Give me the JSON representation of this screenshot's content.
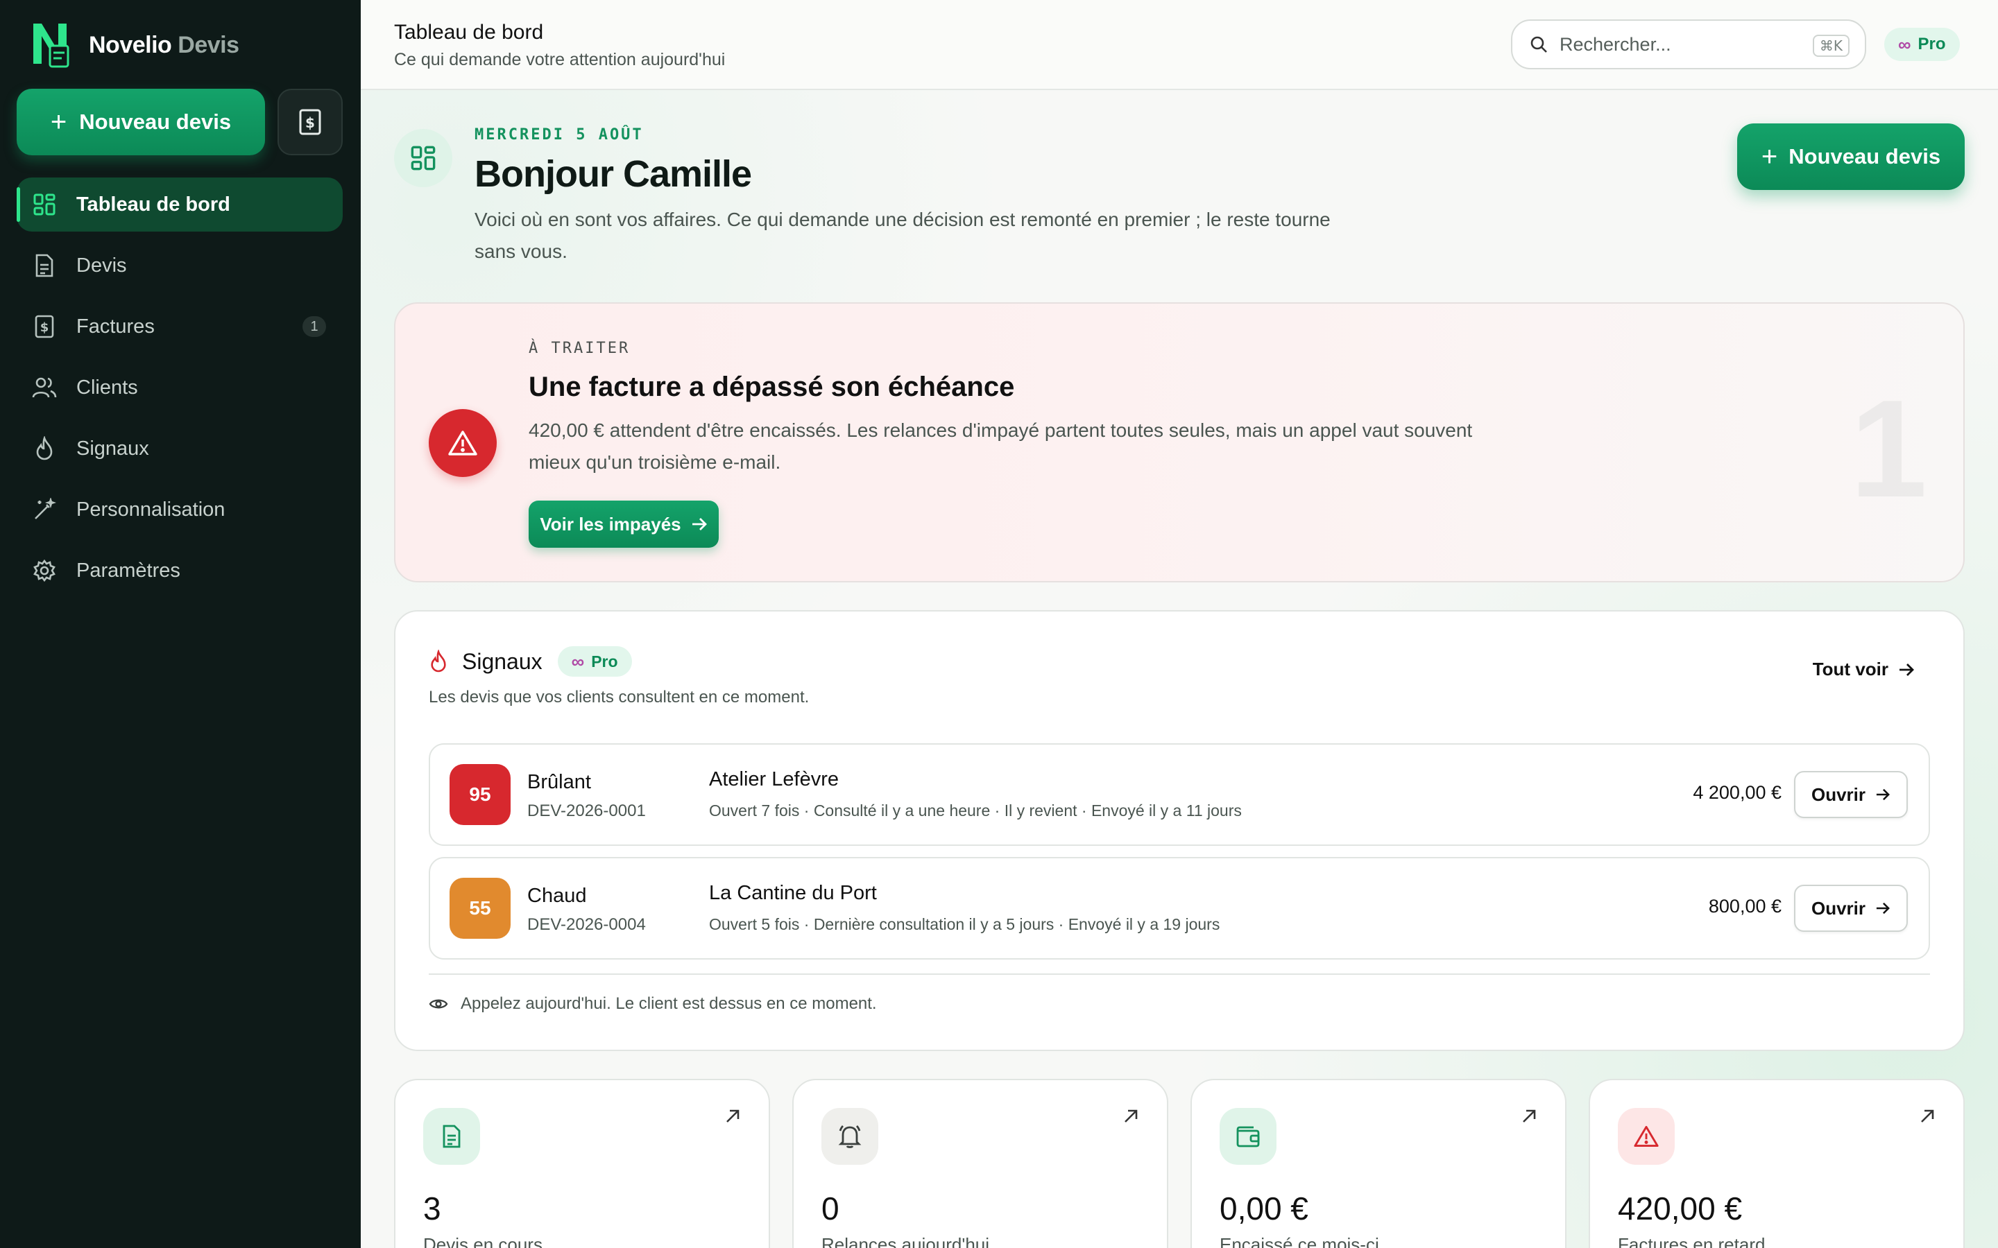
{
  "brand": {
    "name": "Novelio",
    "product": "Devis"
  },
  "sidebar": {
    "new_quote_label": "Nouveau devis",
    "items": [
      {
        "label": "Tableau de bord",
        "icon": "dashboard-icon",
        "active": true
      },
      {
        "label": "Devis",
        "icon": "document-icon"
      },
      {
        "label": "Factures",
        "icon": "invoice-icon",
        "badge": "1"
      },
      {
        "label": "Clients",
        "icon": "users-icon"
      },
      {
        "label": "Signaux",
        "icon": "flame-icon"
      },
      {
        "label": "Personnalisation",
        "icon": "magic-wand-icon"
      },
      {
        "label": "Paramètres",
        "icon": "gear-icon"
      }
    ]
  },
  "topbar": {
    "title": "Tableau de bord",
    "subtitle": "Ce qui demande votre attention aujourd'hui",
    "search_placeholder": "Rechercher...",
    "shortcut": "⌘K",
    "plan": "Pro"
  },
  "hero": {
    "date": "MERCREDI 5 AOÛT",
    "greeting": "Bonjour Camille",
    "intro": "Voici où en sont vos affaires. Ce qui demande une décision est remonté en premier ; le reste tourne sans vous.",
    "new_quote_label": "Nouveau devis"
  },
  "alert": {
    "kicker": "À TRAITER",
    "title": "Une facture a dépassé son échéance",
    "text": "420,00 € attendent d'être encaissés. Les relances d'impayé partent toutes seules, mais un appel vaut souvent mieux qu'un troisième e-mail.",
    "cta": "Voir les impayés",
    "count": "1"
  },
  "signals": {
    "title": "Signaux",
    "badge": "Pro",
    "subtitle": "Les devis que vos clients consultent en ce moment.",
    "see_all": "Tout voir",
    "rows": [
      {
        "score": "95",
        "heat": "Brûlant",
        "ref": "DEV-2026-0001",
        "client": "Atelier Lefèvre",
        "meta": "Ouvert 7 fois · Consulté il y a une heure · Il y revient · Envoyé il y a 11 jours",
        "amount": "4 200,00 €",
        "open": "Ouvrir",
        "color": "#d7282e"
      },
      {
        "score": "55",
        "heat": "Chaud",
        "ref": "DEV-2026-0004",
        "client": "La Cantine du Port",
        "meta": "Ouvert 5 fois · Dernière consultation il y a 5 jours · Envoyé il y a 19 jours",
        "amount": "800,00 €",
        "open": "Ouvrir",
        "color": "#e18a2e"
      }
    ],
    "footer": "Appelez aujourd'hui. Le client est dessus en ce moment."
  },
  "stats": [
    {
      "value": "3",
      "label": "Devis en cours",
      "icon": "document-icon",
      "bg": "#e0f4e9",
      "fg": "#14925e"
    },
    {
      "value": "0",
      "label": "Relances aujourd'hui",
      "icon": "bell-icon",
      "bg": "#efefec",
      "fg": "#3a3f3d"
    },
    {
      "value": "0,00 €",
      "label": "Encaissé ce mois-ci",
      "icon": "wallet-icon",
      "bg": "#e0f4e9",
      "fg": "#14925e"
    },
    {
      "value": "420,00 €",
      "label": "Factures en retard",
      "icon": "warning-icon",
      "bg": "#fde6e6",
      "fg": "#d7282e"
    }
  ]
}
